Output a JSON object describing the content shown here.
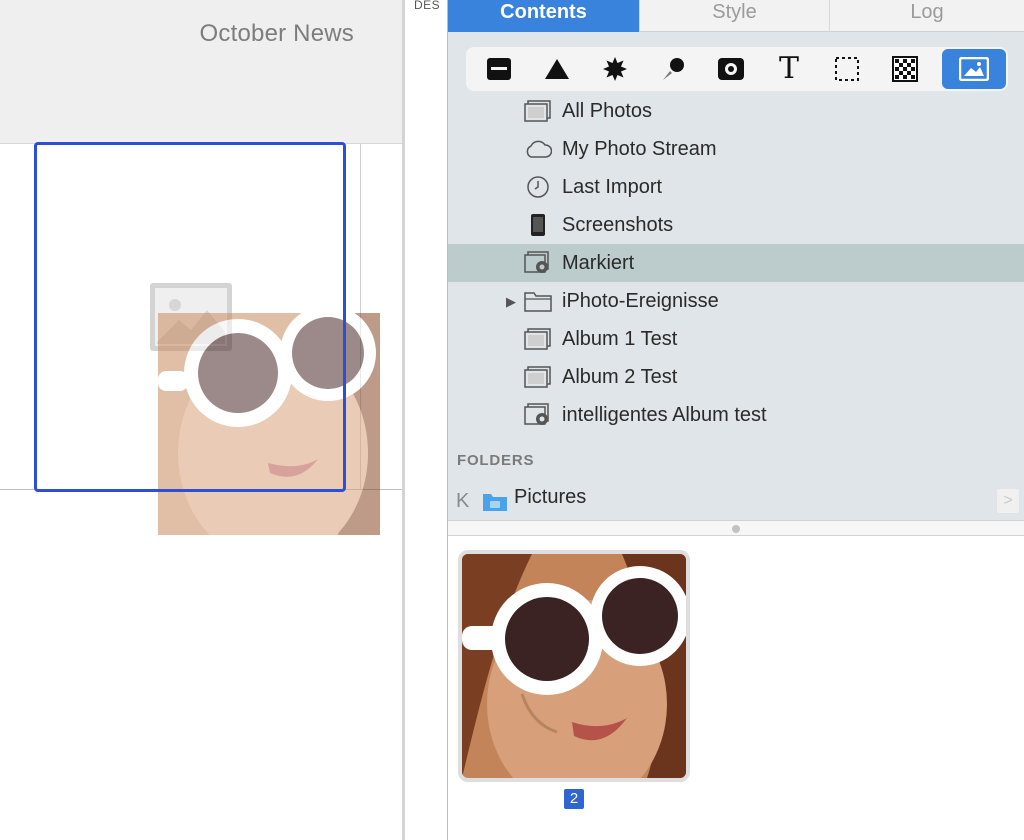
{
  "canvas": {
    "title": "October News"
  },
  "middle": {
    "label": "DES"
  },
  "tabs": [
    {
      "label": "Contents",
      "active": true
    },
    {
      "label": "Style",
      "active": false
    },
    {
      "label": "Log",
      "active": false
    }
  ],
  "toolbar": {
    "tools": [
      "layout-icon",
      "triangle-icon",
      "starburst-icon",
      "brush-icon",
      "photo-icon",
      "text-icon",
      "selection-icon",
      "pattern-icon",
      "image-icon"
    ],
    "active_tool": "image-icon"
  },
  "sources": [
    {
      "label": "All Photos",
      "icon": "album-icon"
    },
    {
      "label": "My Photo Stream",
      "icon": "cloud-icon"
    },
    {
      "label": "Last Import",
      "icon": "clock-icon"
    },
    {
      "label": "Screenshots",
      "icon": "phone-icon"
    },
    {
      "label": "Markiert",
      "icon": "smart-album-icon",
      "selected": true
    },
    {
      "label": "iPhoto-Ereignisse",
      "icon": "folder-icon",
      "expandable": true
    },
    {
      "label": "Album 1 Test",
      "icon": "album-icon"
    },
    {
      "label": "Album 2 Test",
      "icon": "album-icon"
    },
    {
      "label": "intelligentes Album test",
      "icon": "smart-album-icon"
    }
  ],
  "folders": {
    "heading": "FOLDERS",
    "path_item": "Pictures"
  },
  "thumbnails": [
    {
      "badge": "2"
    }
  ],
  "colors": {
    "accent": "#3a83dd",
    "selection": "#bccbcb",
    "frame": "#2d4fd6"
  }
}
